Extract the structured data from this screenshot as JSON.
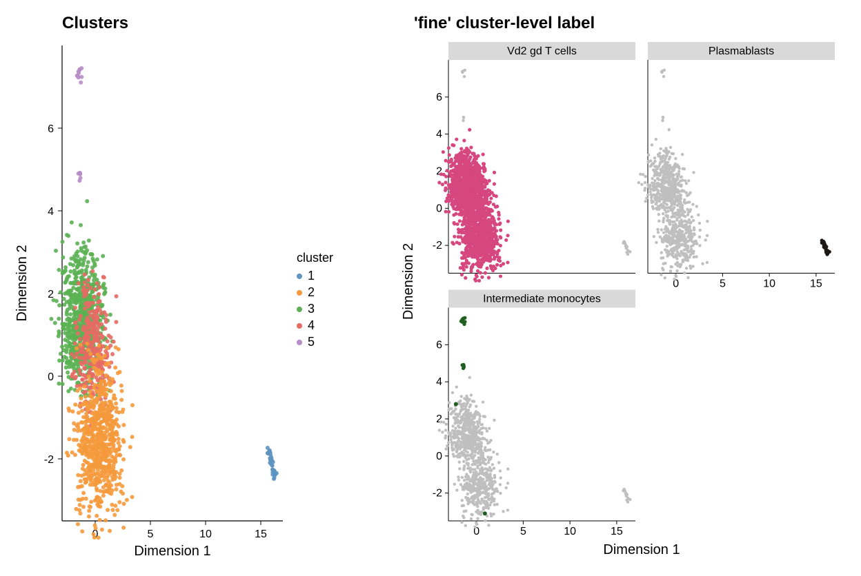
{
  "left": {
    "title": "Clusters",
    "xlabel": "Dimension 1",
    "ylabel": "Dimension 2",
    "legend_title": "cluster",
    "legend": [
      {
        "label": "1",
        "color": "#5e94c2"
      },
      {
        "label": "2",
        "color": "#f59a3c"
      },
      {
        "label": "3",
        "color": "#5bb153"
      },
      {
        "label": "4",
        "color": "#e76a64"
      },
      {
        "label": "5",
        "color": "#b68dc7"
      }
    ],
    "xlim": [
      -3,
      17
    ],
    "ylim": [
      -3.5,
      8
    ],
    "xticks": [
      0,
      5,
      10,
      15
    ],
    "yticks": [
      -2,
      0,
      2,
      4,
      6
    ]
  },
  "right": {
    "title": "'fine' cluster-level label",
    "xlabel": "Dimension 1",
    "ylabel": "Dimension 2",
    "facets": [
      {
        "name": "Vd2 gd T cells",
        "color": "#d6467f",
        "highlight": "A"
      },
      {
        "name": "Plasmablasts",
        "color": "#1d1915",
        "highlight": "B"
      },
      {
        "name": "Intermediate monocytes",
        "color": "#1f5e1f",
        "highlight": "C"
      }
    ],
    "xlim": [
      -3,
      17
    ],
    "ylim": [
      -3.5,
      8
    ],
    "xticks": [
      0,
      5,
      10,
      15
    ],
    "yticks": [
      -2,
      0,
      2,
      4,
      6
    ]
  },
  "chart_data": {
    "type": "scatter",
    "xlabel": "Dimension 1",
    "ylabel": "Dimension 2",
    "xlim": [
      -3,
      17
    ],
    "ylim": [
      -3.5,
      8
    ],
    "clusters": {
      "1": {
        "color": "#5e94c2",
        "approx_center": [
          16,
          -2.1
        ],
        "count": 35,
        "spread": 0.35
      },
      "2": {
        "color": "#f59a3c",
        "approx_center": [
          0.5,
          -1.6
        ],
        "count": 700,
        "spread": 1.4
      },
      "3": {
        "color": "#5bb153",
        "approx_center": [
          -1.2,
          1.4
        ],
        "count": 700,
        "spread": 1.3
      },
      "4": {
        "color": "#e76a64",
        "approx_center": [
          0.0,
          0.7
        ],
        "count": 300,
        "spread": 1.0
      },
      "5": {
        "color": "#b68dc7",
        "approx_center": [
          -1.2,
          6.2
        ],
        "count": 15,
        "spread": 0.3,
        "extra": [
          [
            -1.4,
            7.2
          ],
          [
            -1.3,
            4.85
          ]
        ]
      }
    },
    "facets": [
      {
        "name": "Vd2 gd T cells",
        "highlight_color": "#d6467f",
        "highlighted_clusters": [
          "2",
          "3",
          "4"
        ]
      },
      {
        "name": "Plasmablasts",
        "highlight_color": "#1d1915",
        "highlighted_clusters": [
          "1"
        ]
      },
      {
        "name": "Intermediate monocytes",
        "highlight_color": "#1f5e1f",
        "highlighted_clusters": [
          "5"
        ],
        "extra_points": [
          [
            -2.2,
            2.8
          ],
          [
            0.9,
            -3.1
          ]
        ]
      }
    ]
  }
}
